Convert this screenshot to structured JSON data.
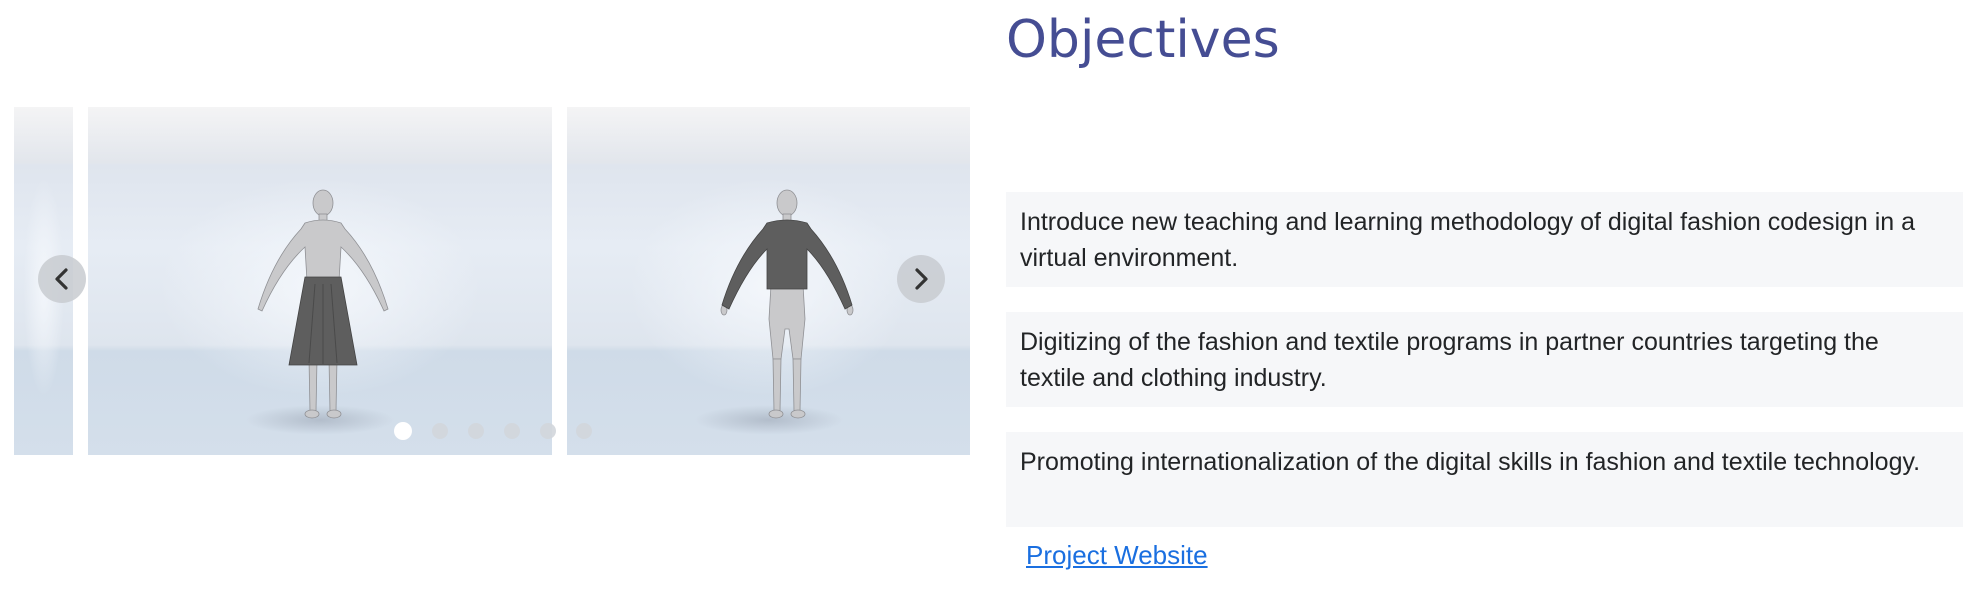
{
  "section": {
    "title": "Objectives"
  },
  "objectives": [
    {
      "text": "Introduce new teaching and learning methodology of digital fashion codesign in a virtual environment."
    },
    {
      "text": "Digitizing of the fashion and textile programs in partner countries targeting the textile and clothing industry."
    },
    {
      "text": "Promoting internationalization of the digital skills in fashion and textile technology."
    }
  ],
  "link": {
    "label": "Project Website"
  },
  "carousel": {
    "slides": [
      {
        "garment": "none"
      },
      {
        "garment": "skirt"
      },
      {
        "garment": "long-sleeve-top"
      }
    ],
    "dot_count": 6,
    "active_dot": 1,
    "icons": {
      "prev": "chevron-left-icon",
      "next": "chevron-right-icon"
    }
  },
  "colors": {
    "title": "#454d93",
    "link": "#1a6fe0",
    "objective_bg": "#f6f7f9",
    "garment": "#5e5e5e"
  }
}
